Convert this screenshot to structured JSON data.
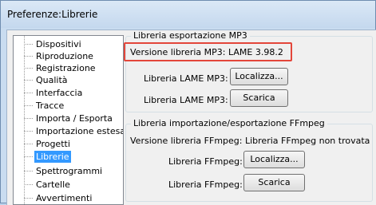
{
  "window": {
    "title": "Preferenze:Librerie"
  },
  "sidebar": {
    "items": [
      {
        "label": "Dispositivi"
      },
      {
        "label": "Riproduzione"
      },
      {
        "label": "Registrazione"
      },
      {
        "label": "Qualità"
      },
      {
        "label": "Interfaccia"
      },
      {
        "label": "Tracce"
      },
      {
        "label": "Importa / Esporta"
      },
      {
        "label": "Importazione estesa"
      },
      {
        "label": "Progetti"
      },
      {
        "label": "Librerie",
        "selected": true
      },
      {
        "label": "Spettrogrammi"
      },
      {
        "label": "Cartelle"
      },
      {
        "label": "Avvertimenti"
      }
    ]
  },
  "mp3": {
    "group_title": "Libreria esportazione MP3",
    "version_text": "Versione libreria MP3: LAME 3.98.2",
    "lame_label_1": "Libreria LAME MP3:",
    "locate_button": "Localizza...",
    "lame_label_2": "Libreria LAME MP3:",
    "download_button": "Scarica"
  },
  "ffmpeg": {
    "group_title": "Libreria importazione/esportazione FFmpeg",
    "version_text": "Versione libreria FFmpeg: Libreria FFmpeg non trovata",
    "lib_label_1": "Libreria FFmpeg:",
    "locate_button": "Localizza...",
    "lib_label_2": "Libreria FFmpeg:",
    "download_button": "Scarica"
  },
  "colors": {
    "highlight": "#e3463a",
    "selection": "#3399ff"
  }
}
